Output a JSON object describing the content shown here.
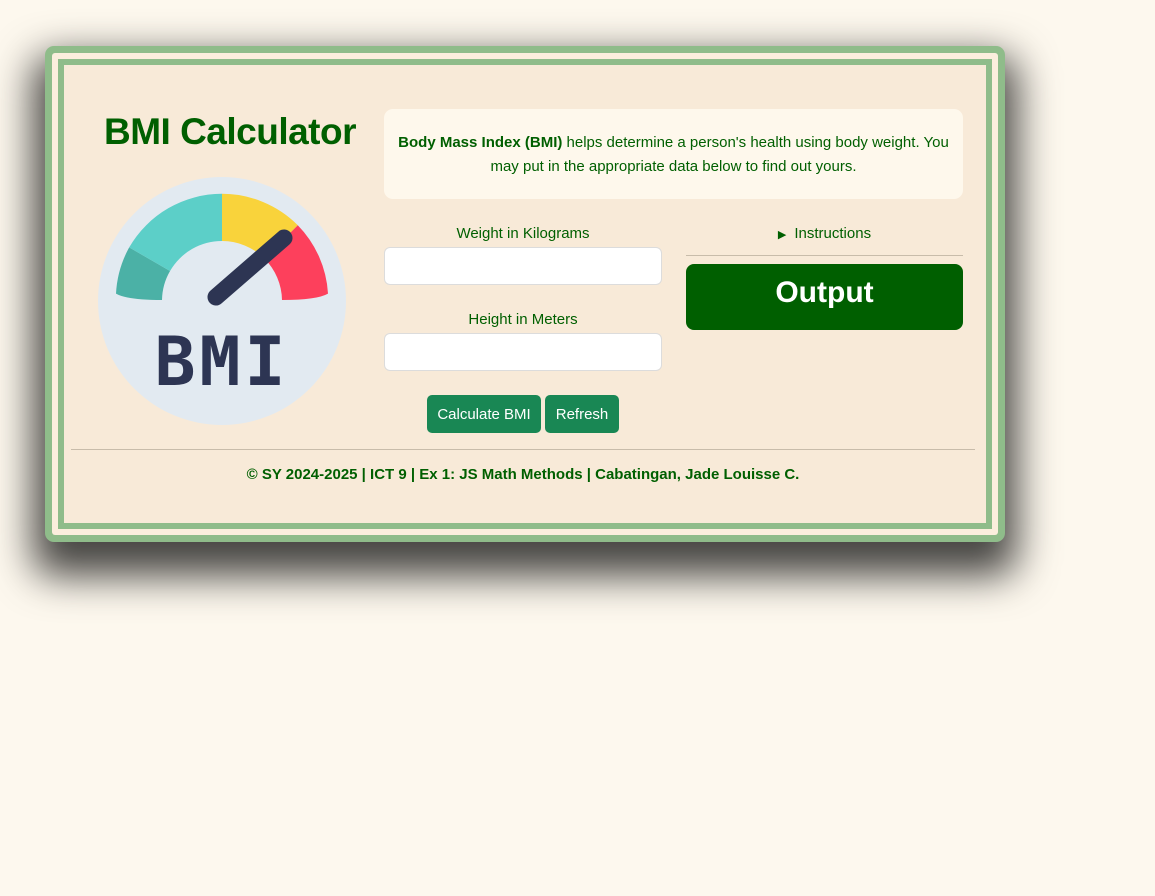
{
  "app": {
    "title": "BMI Calculator"
  },
  "logo": {
    "text": "BMI",
    "colors": {
      "background": "#e2eaf1",
      "teal_dark": "#4bb1a6",
      "teal_light": "#5ccfc8",
      "yellow": "#f9d33b",
      "red": "#fd405c",
      "needle": "#2d3553"
    }
  },
  "info": {
    "bold": "Body Mass Index (BMI)",
    "text": " helps determine a person's health using body weight. You may put in the appropriate data below to find out yours."
  },
  "form": {
    "weight_label": "Weight in Kilograms",
    "weight_value": "",
    "height_label": "Height in Meters",
    "height_value": "",
    "calculate_label": "Calculate BMI",
    "refresh_label": "Refresh"
  },
  "instructions": {
    "label": "Instructions",
    "icon": "triangle-right-icon"
  },
  "output": {
    "label": "Output"
  },
  "footer": {
    "text": "© SY 2024-2025 | ICT 9 | Ex 1: JS Math Methods | Cabatingan, Jade Louisse C."
  },
  "theme": {
    "accent_green": "#005f00",
    "button_green": "#198754",
    "border_green": "#8fbc8a",
    "page_bg": "#fdf8ee",
    "panel_bg": "#f8ead8"
  }
}
